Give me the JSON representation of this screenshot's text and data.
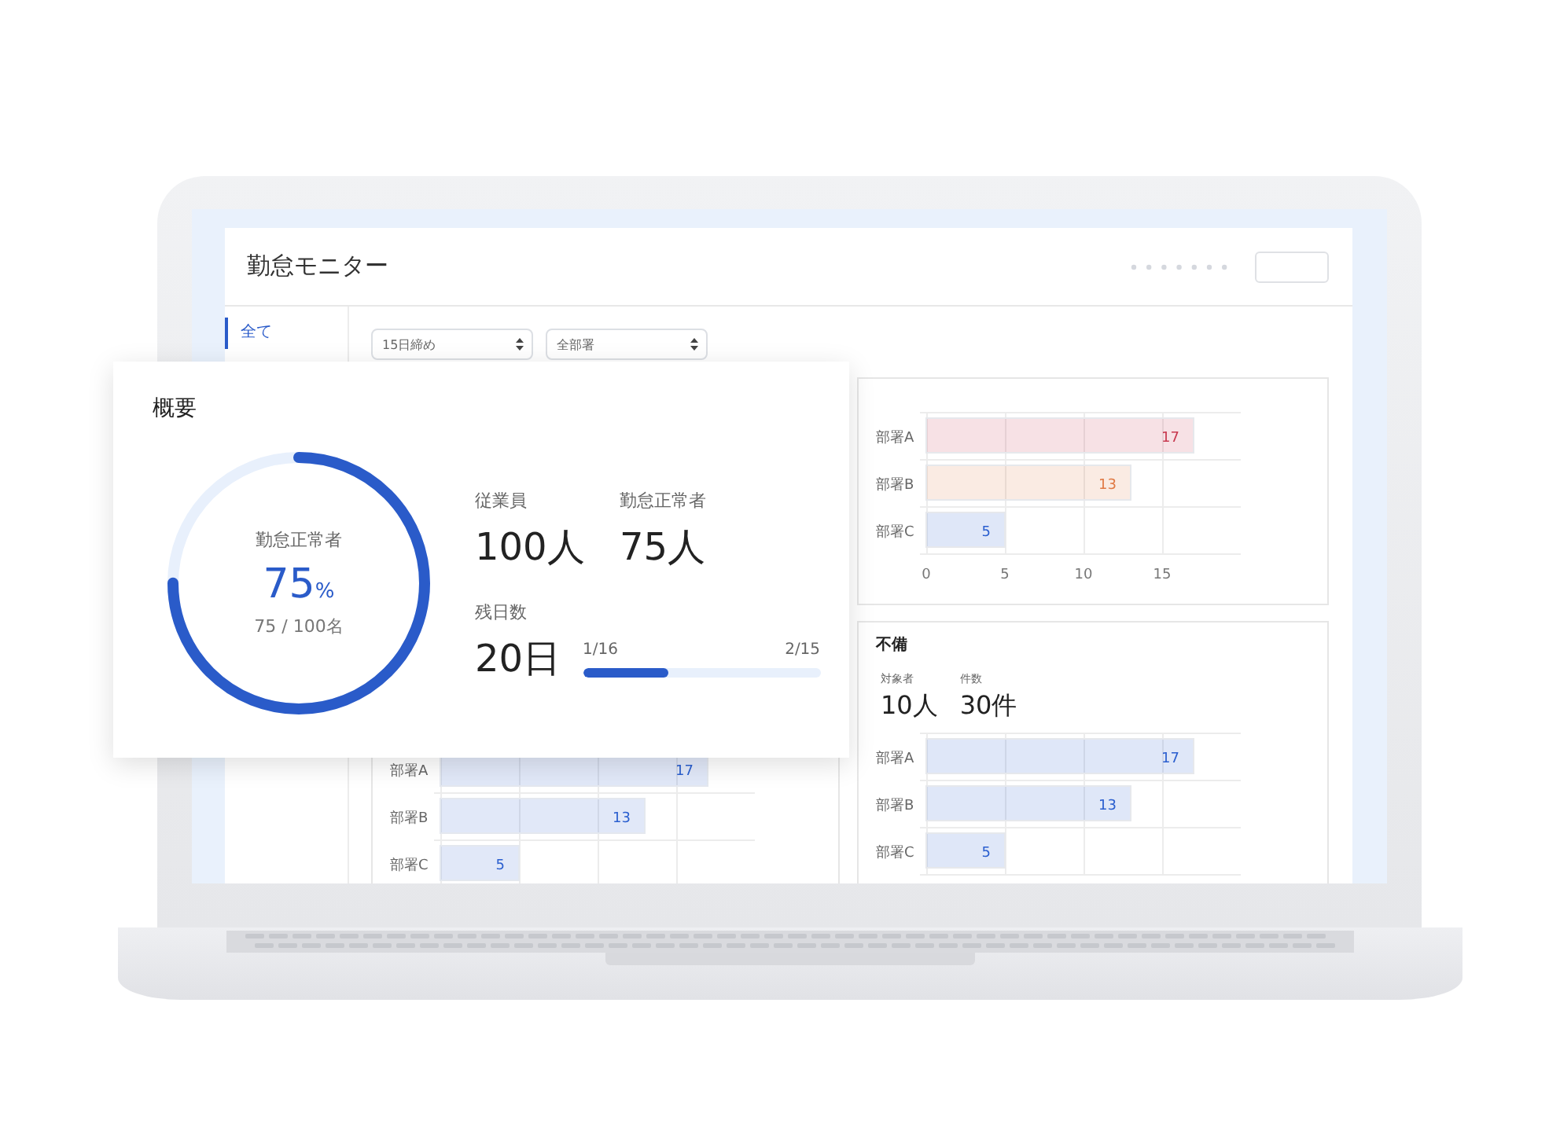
{
  "app": {
    "title": "勤怠モニター",
    "sidebar": [
      {
        "label": "全て",
        "selected": true
      }
    ],
    "filters": [
      {
        "value": "15日締め"
      },
      {
        "value": "全部署"
      }
    ],
    "left_card": {
      "chart_data": {
        "type": "bar",
        "orientation": "horizontal",
        "categories": [
          "部署A",
          "部署B",
          "部署C"
        ],
        "series": [
          {
            "color": "#2b5fcf",
            "values": [
              17,
              13,
              5
            ]
          }
        ],
        "xlim": [
          0,
          20
        ],
        "grid": true,
        "data_labels": true
      }
    },
    "right_cards": [
      {
        "chart_data": {
          "type": "bar",
          "orientation": "horizontal",
          "categories": [
            "部署A",
            "部署B",
            "部署C"
          ],
          "series": [
            {
              "color": "#c8394f",
              "values": [
                17,
                null,
                null
              ]
            },
            {
              "color": "#e07a45",
              "values": [
                null,
                13,
                null
              ]
            },
            {
              "color": "#2b5fcf",
              "values": [
                null,
                null,
                5
              ]
            }
          ],
          "stacked": true,
          "xlim": [
            0,
            20
          ],
          "xticks": [
            0,
            5,
            10,
            15
          ],
          "grid": true,
          "data_labels": true
        }
      },
      {
        "title": "不備",
        "stats": [
          {
            "label": "対象者",
            "value": "10人"
          },
          {
            "label": "件数",
            "value": "30件"
          }
        ],
        "chart_data": {
          "type": "bar",
          "orientation": "horizontal",
          "categories": [
            "部署A",
            "部署B",
            "部署C"
          ],
          "series": [
            {
              "color": "#2b5fcf",
              "values": [
                17,
                13,
                5
              ]
            }
          ],
          "xlim": [
            0,
            20
          ],
          "grid": true,
          "data_labels": true
        }
      }
    ]
  },
  "overview": {
    "title": "概要",
    "ring": {
      "caption": "勤怠正常者",
      "value": "75",
      "unit": "%",
      "detail": "75 / 100名",
      "level": 0.75
    },
    "stats": [
      {
        "label": "従業員",
        "value": "100人"
      },
      {
        "label": "勤怠正常者",
        "value": "75人"
      }
    ],
    "remaining": {
      "label": "残日数",
      "value": "20日",
      "start": "1/16",
      "end": "2/15",
      "level": 0.36
    }
  }
}
